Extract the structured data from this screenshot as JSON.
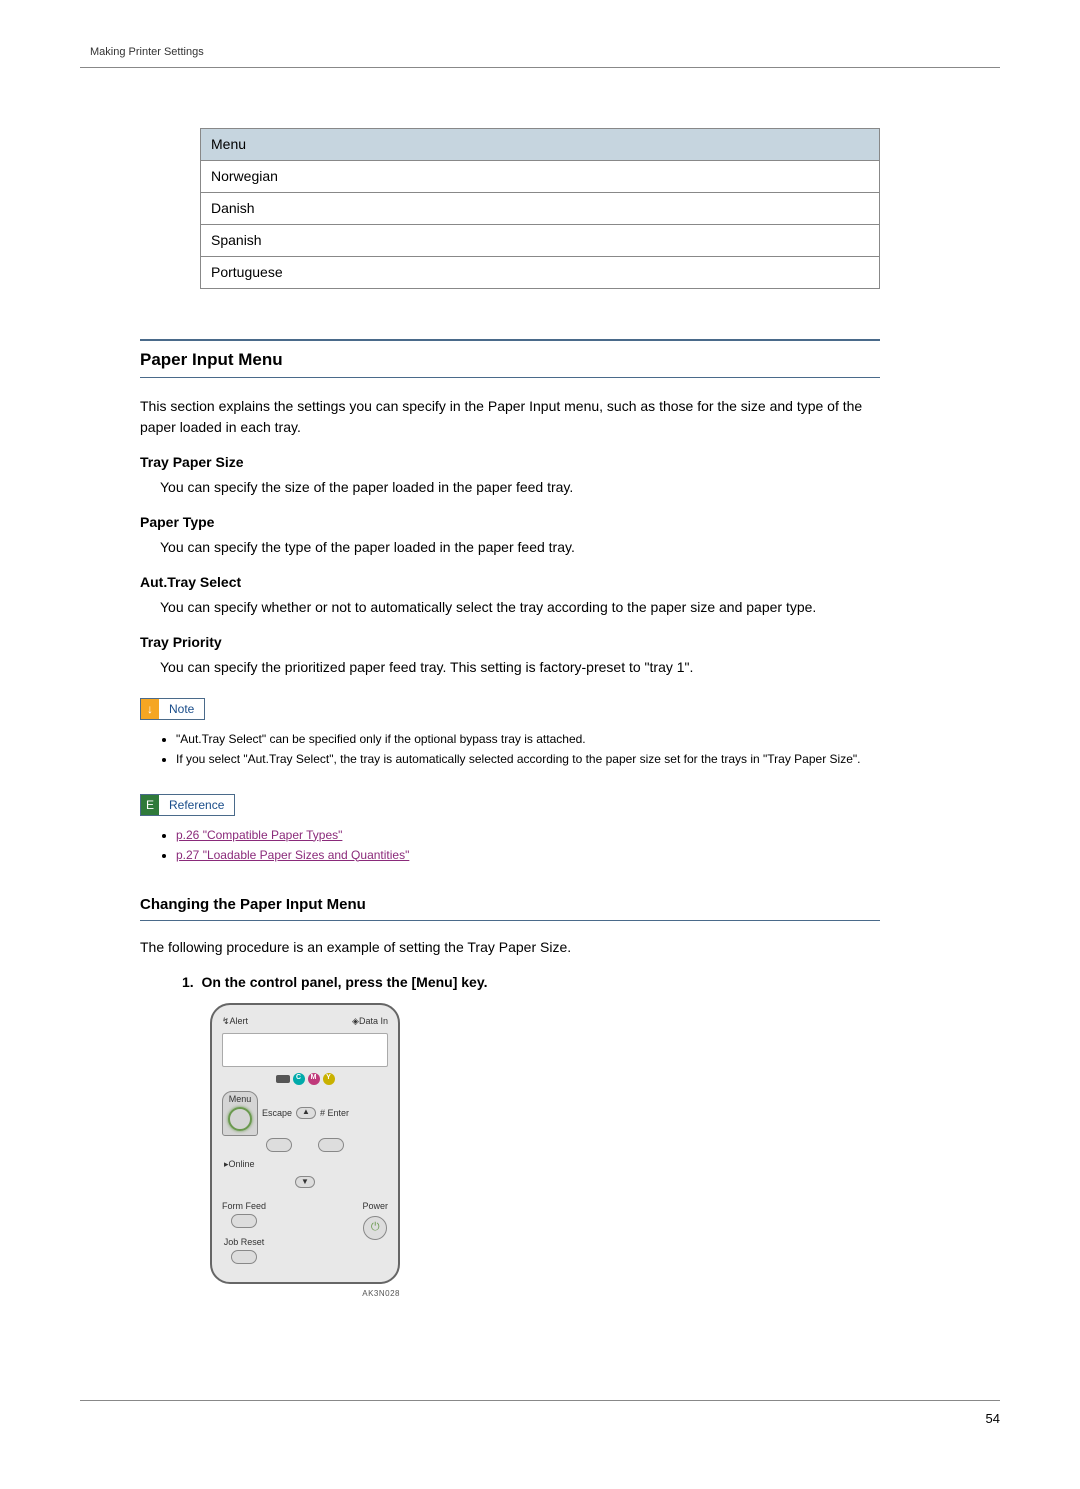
{
  "header": {
    "breadcrumb": "Making Printer Settings"
  },
  "menu_table": {
    "header": "Menu",
    "rows": [
      "Norwegian",
      "Danish",
      "Spanish",
      "Portuguese"
    ]
  },
  "section1": {
    "title": "Paper Input Menu",
    "intro": "This section explains the settings you can specify in the Paper Input menu, such as those for the size and type of the paper loaded in each tray.",
    "defs": [
      {
        "term": "Tray Paper Size",
        "desc": "You can specify the size of the paper loaded in the paper feed tray."
      },
      {
        "term": "Paper Type",
        "desc": "You can specify the type of the paper loaded in the paper feed tray."
      },
      {
        "term": "Aut.Tray Select",
        "desc": "You can specify whether or not to automatically select the tray according to the paper size and paper type."
      },
      {
        "term": "Tray Priority",
        "desc": "You can specify the prioritized paper feed tray. This setting is factory-preset to \"tray 1\"."
      }
    ]
  },
  "note": {
    "label": "Note",
    "items": [
      "\"Aut.Tray Select\" can be specified only if the optional bypass tray is attached.",
      "If you select \"Aut.Tray Select\", the tray is automatically selected according to the paper size set for the trays in \"Tray Paper Size\"."
    ]
  },
  "reference": {
    "label": "Reference",
    "items": [
      "p.26 \"Compatible Paper Types\"",
      "p.27 \"Loadable Paper Sizes and Quantities\""
    ]
  },
  "section2": {
    "title": "Changing the Paper Input Menu",
    "intro": "The following procedure is an example of setting the Tray Paper Size.",
    "step1": "On the control panel, press the [Menu] key."
  },
  "panel": {
    "alert": "Alert",
    "data_in": "Data In",
    "c": "C",
    "m": "M",
    "y": "Y",
    "menu": "Menu",
    "escape": "Escape",
    "enter": "# Enter",
    "online": "Online",
    "form_feed": "Form Feed",
    "job_reset": "Job Reset",
    "power": "Power",
    "fig_id": "AK3N028"
  },
  "footer": {
    "page": "54"
  }
}
